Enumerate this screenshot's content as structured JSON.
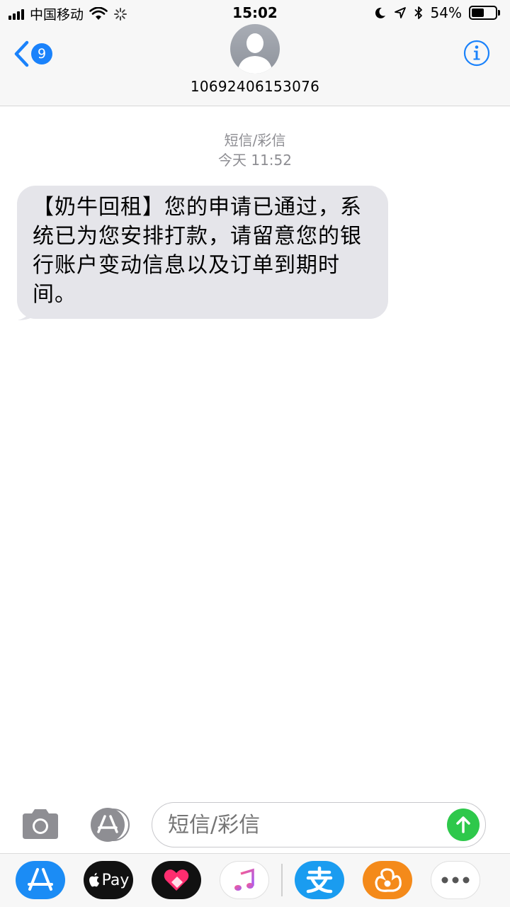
{
  "status_bar": {
    "carrier": "中国移动",
    "time": "15:02",
    "battery": "54%",
    "battery_level": 0.54
  },
  "header": {
    "back_count": "9",
    "contact": "10692406153076"
  },
  "thread": {
    "timestamp_type": "短信/彩信",
    "timestamp_time": "今天 11:52",
    "messages": [
      {
        "text": "【奶牛回租】您的申请已通过，系统已为您安排打款，请留意您的银行账户变动信息以及订单到期时间。"
      }
    ]
  },
  "composer": {
    "placeholder": "短信/彩信"
  },
  "app_drawer": {
    "apple_pay_label": "Pay"
  },
  "colors": {
    "accent": "#1a82fb",
    "send": "#2ec84b",
    "bubble": "#e5e5ea"
  }
}
